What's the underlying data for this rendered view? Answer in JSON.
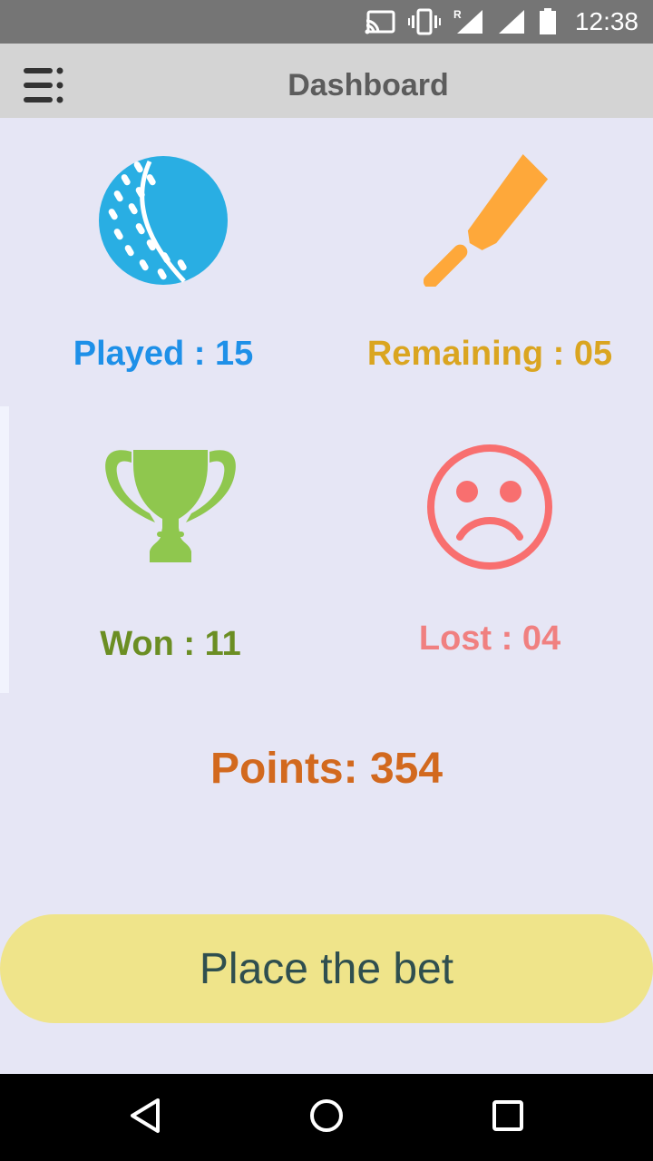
{
  "status_bar": {
    "time": "12:38",
    "icons": [
      "cast-icon",
      "vibrate-icon",
      "signal-roaming-icon",
      "signal-icon",
      "battery-icon"
    ]
  },
  "app_bar": {
    "title": "Dashboard",
    "menu_icon": "menu-icon"
  },
  "stats": {
    "played": {
      "label": "Played : 15",
      "icon": "cricket-ball-icon",
      "color": "#1e90e8"
    },
    "remaining": {
      "label": "Remaining : 05",
      "icon": "cricket-bat-icon",
      "color": "#daa520"
    },
    "won": {
      "label": "Won : 11",
      "icon": "trophy-icon",
      "color": "#6b8e23"
    },
    "lost": {
      "label": "Lost : 04",
      "icon": "sad-face-icon",
      "color": "#f08080"
    }
  },
  "points": "Points: 354",
  "bet_button": "Place the bet",
  "nav_bar": {
    "buttons": [
      "back-icon",
      "home-icon",
      "recents-icon"
    ]
  }
}
